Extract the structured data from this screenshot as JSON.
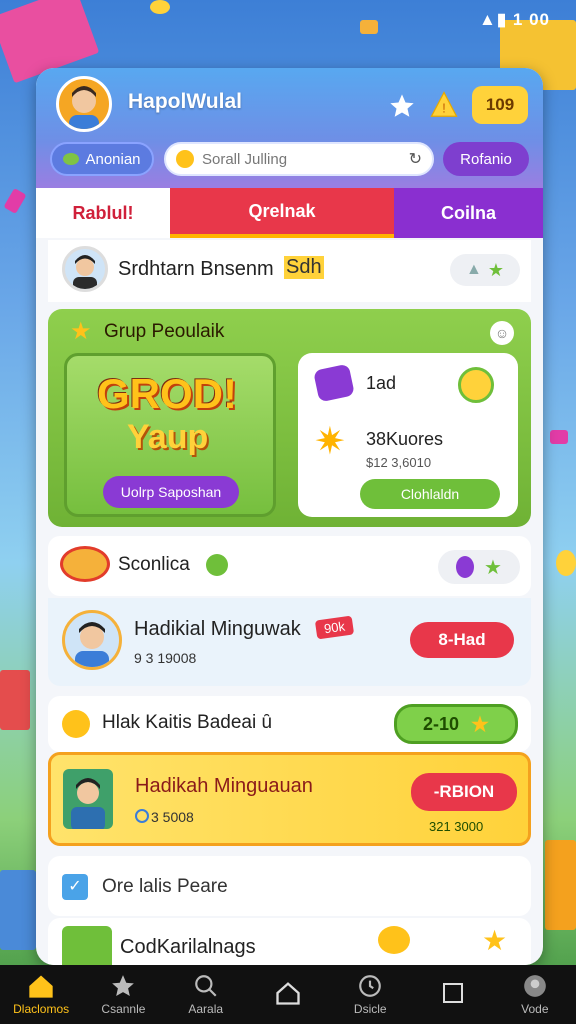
{
  "status_bar": {
    "text": "▲▮ 1 00"
  },
  "header": {
    "title": "HapolWulal",
    "score": "109",
    "tag_label": "Anonian",
    "search_placeholder": "Sorall Julling",
    "right_button": "Rofanio"
  },
  "tabs": [
    {
      "label": "Rablul!"
    },
    {
      "label": "Qrelnak"
    },
    {
      "label": "Coilna"
    }
  ],
  "profile_row": {
    "name": "Srdhtarn Bnsenm",
    "badge": "Sdh"
  },
  "group_card": {
    "title": "Grup Peoulaik",
    "logo_line1": "GROD!",
    "logo_line2": "Yaup",
    "logo_button": "Uolrp Saposhan",
    "stat1": "1ad",
    "stat2": "38Kuores",
    "stat2_sub": "$12 3,6010",
    "action_button": "Clohlaldn"
  },
  "section1": {
    "title": "Sconlica",
    "player_name": "Hadikial Minguwak",
    "player_tag": "90k",
    "player_score": "9 3 19008",
    "player_button": "8-Had"
  },
  "section2": {
    "title": "Hlak Kaitis Badeai ȗ",
    "pill_value": "2-10",
    "player_name": "Hadikah Minguauan",
    "player_score": "3 5008",
    "player_button": "-RBION",
    "player_sub": "321 3000"
  },
  "section3": {
    "title": "Ore lalis Peare",
    "item_title": "CodKarilalnags"
  },
  "bottom_nav": [
    {
      "label": "Dlaclomos"
    },
    {
      "label": "Csannle"
    },
    {
      "label": "Aarala"
    },
    {
      "label": ""
    },
    {
      "label": "Dsicle"
    },
    {
      "label": ""
    },
    {
      "label": "Vode"
    }
  ],
  "colors": {
    "accent_red": "#e8374a",
    "accent_purple": "#8a2fd0",
    "green": "#6fbf3a",
    "orange": "#f4a11e",
    "yellow": "#f7c21a"
  }
}
